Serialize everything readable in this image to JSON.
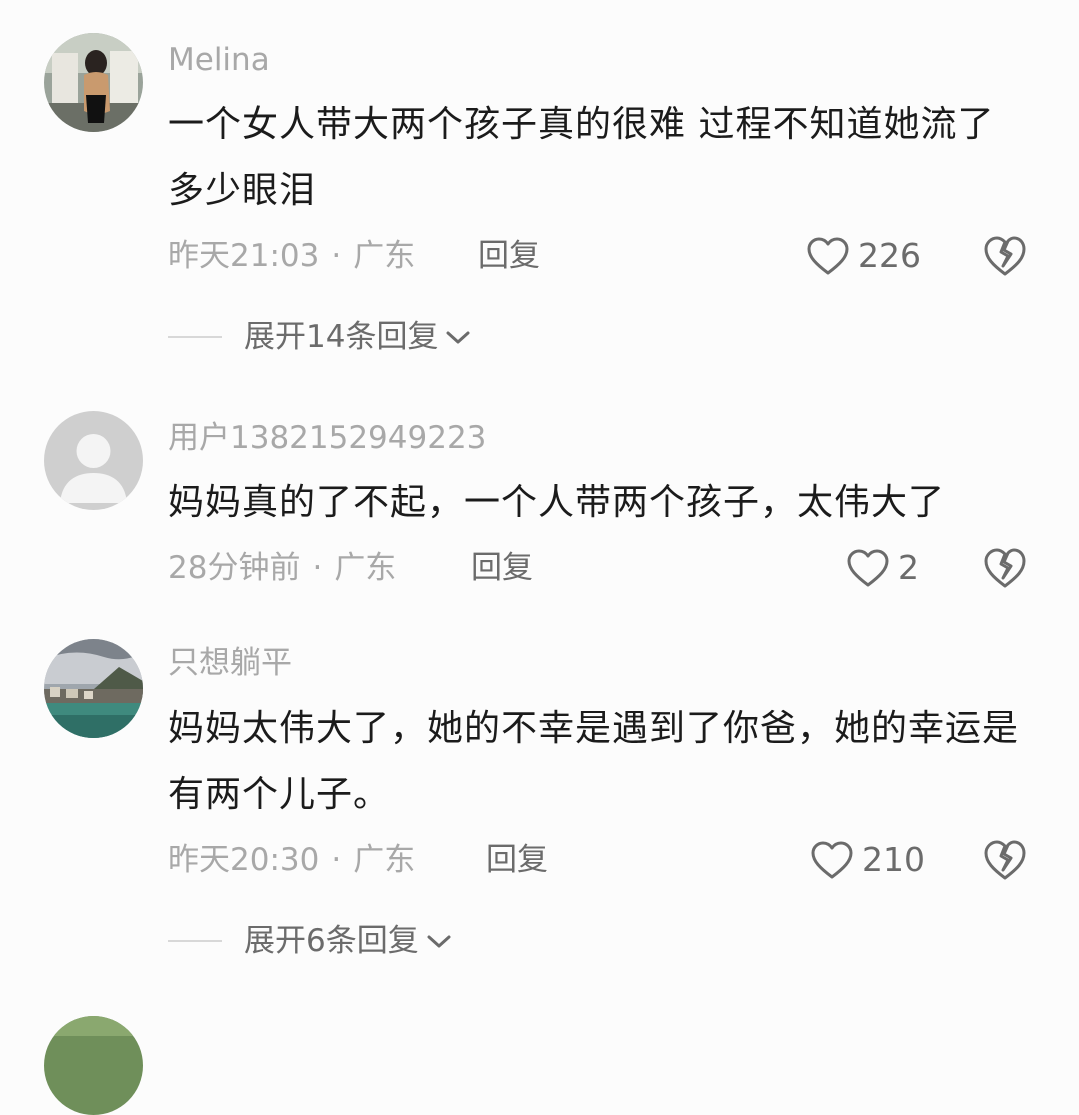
{
  "comments": [
    {
      "username": "Melina",
      "text": "一个女人带大两个孩子真的很难 过程不知道她流了多少眼泪",
      "time": "昨天21:03",
      "separator": "·",
      "location": "广东",
      "reply_label": "回复",
      "likes": "226",
      "expand_label": "展开14条回复"
    },
    {
      "username": "用户1382152949223",
      "text": "妈妈真的了不起，一个人带两个孩子，太伟大了",
      "time": "28分钟前",
      "separator": "·",
      "location": "广东",
      "reply_label": "回复",
      "likes": "2"
    },
    {
      "username": "只想躺平",
      "text": "妈妈太伟大了，她的不幸是遇到了你爸，她的幸运是有两个儿子。",
      "time": "昨天20:30",
      "separator": "·",
      "location": "广东",
      "reply_label": "回复",
      "likes": "210",
      "expand_label": "展开6条回复"
    }
  ],
  "icons": {
    "like": "heart-outline-icon",
    "dislike": "broken-heart-icon",
    "expand": "chevron-down-icon",
    "avatar_placeholder": "default-user-icon"
  },
  "colors": {
    "background": "#fcfcfc",
    "text_primary": "#1b1b1b",
    "text_secondary": "#a8a8a8",
    "text_action": "#6b6b6b"
  }
}
